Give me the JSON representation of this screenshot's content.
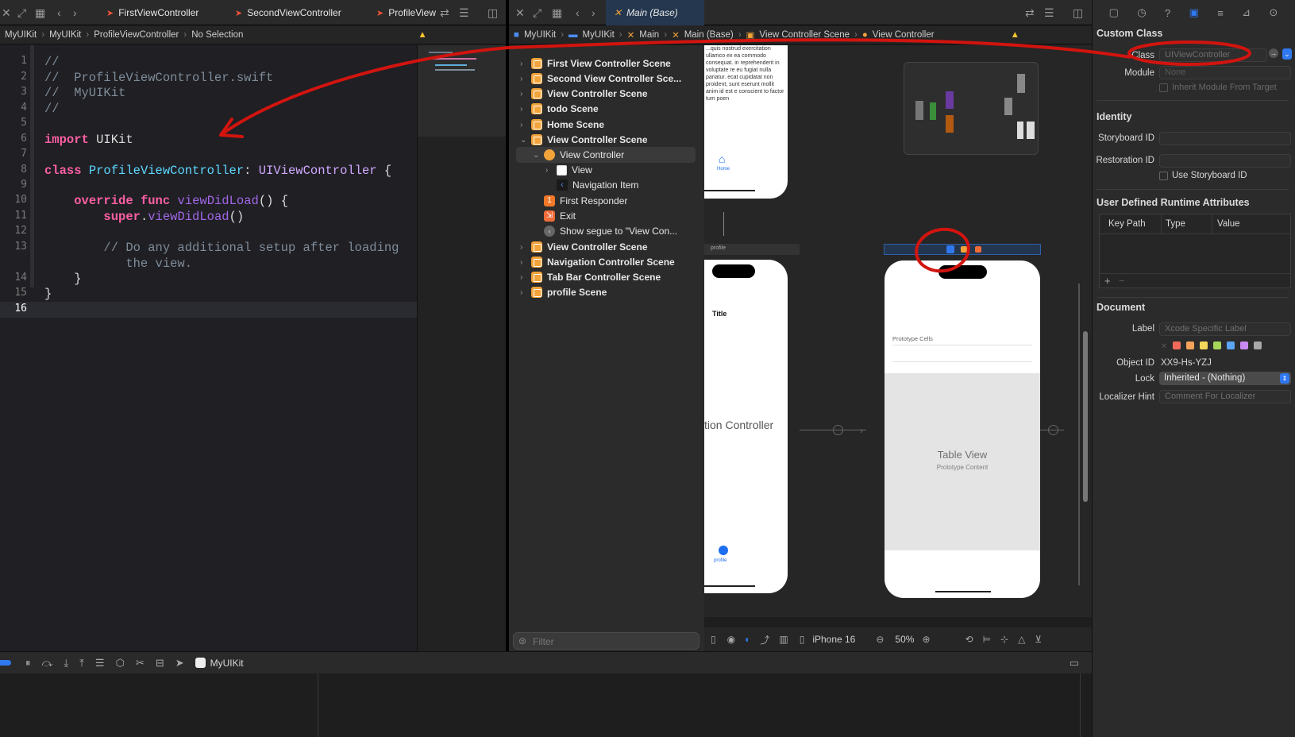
{
  "editor": {
    "tabs": [
      "FirstViewController",
      "SecondViewController",
      "ProfileView"
    ],
    "breadcrumb": [
      "MyUIKit",
      "MyUIKit",
      "ProfileViewController",
      "No Selection"
    ],
    "lines": [
      {
        "n": "1",
        "t": "//"
      },
      {
        "n": "2",
        "t": "//  ProfileViewController.swift"
      },
      {
        "n": "3",
        "t": "//  MyUIKit"
      },
      {
        "n": "4",
        "t": "//"
      },
      {
        "n": "5",
        "t": ""
      },
      {
        "n": "6",
        "t": "import UIKit"
      },
      {
        "n": "7",
        "t": ""
      },
      {
        "n": "8",
        "t": "class ProfileViewController: UIViewController {"
      },
      {
        "n": "9",
        "t": ""
      },
      {
        "n": "10",
        "t": "    override func viewDidLoad() {"
      },
      {
        "n": "11",
        "t": "        super.viewDidLoad()"
      },
      {
        "n": "12",
        "t": ""
      },
      {
        "n": "13",
        "t": "        // Do any additional setup after loading\n           the view."
      },
      {
        "n": "14",
        "t": "    }"
      },
      {
        "n": "15",
        "t": "}"
      },
      {
        "n": "16",
        "t": ""
      }
    ]
  },
  "storyboard": {
    "tab": "Main (Base)",
    "breadcrumb": [
      "MyUIKit",
      "MyUIKit",
      "Main",
      "Main (Base)",
      "View Controller Scene",
      "View Controller"
    ],
    "outline": [
      "First View Controller Scene",
      "Second View Controller Sce...",
      "View Controller Scene",
      "todo Scene",
      "Home Scene",
      "View Controller Scene",
      "View Controller",
      "View",
      "Navigation Item",
      "First Responder",
      "Exit",
      "Show segue to \"View Con...",
      "View Controller Scene",
      "Navigation Controller Scene",
      "Tab Bar Controller Scene",
      "profile Scene"
    ],
    "filter_placeholder": "Filter",
    "canvas": {
      "lorem": "...quis nostrud exercitation ullamco ex ea commodo consequat. in reprehenderit in voluptate re eu fugiat nulla pariatur. ecat cupidatat non proident, sunt eserunt mollit anim id est e conscient to factor tum poen",
      "home_tab": "Home",
      "profile_bar": "profile",
      "title_label": "Title",
      "nav_controller_fragment": "tion Controller",
      "profile_tab": "profile",
      "prototype_cells": "Prototype Cells",
      "table_view": "Table View",
      "prototype_content": "Prototype Content"
    },
    "bottom_bar": {
      "device": "iPhone 16",
      "zoom": "50%"
    }
  },
  "debug_bar": {
    "scheme": "MyUIKit"
  },
  "inspector": {
    "custom_class_title": "Custom Class",
    "class_label": "Class",
    "class_placeholder": "UIViewController",
    "module_label": "Module",
    "module_value": "None",
    "inherit_label": "Inherit Module From Target",
    "identity_title": "Identity",
    "storyboard_id_label": "Storyboard ID",
    "restoration_id_label": "Restoration ID",
    "use_storyboard_id_label": "Use Storyboard ID",
    "runtime_title": "User Defined Runtime Attributes",
    "cols": [
      "Key Path",
      "Type",
      "Value"
    ],
    "document_title": "Document",
    "label_label": "Label",
    "label_placeholder": "Xcode Specific Label",
    "object_id_label": "Object ID",
    "object_id_value": "XX9-Hs-YZJ",
    "lock_label": "Lock",
    "lock_value": "Inherited - (Nothing)",
    "localizer_label": "Localizer Hint",
    "localizer_placeholder": "Comment For Localizer",
    "label_colors": [
      "#f36a5b",
      "#f5a35a",
      "#f4d75a",
      "#a6d65a",
      "#5aa6f4",
      "#c88af0",
      "#a8a8a8"
    ]
  }
}
